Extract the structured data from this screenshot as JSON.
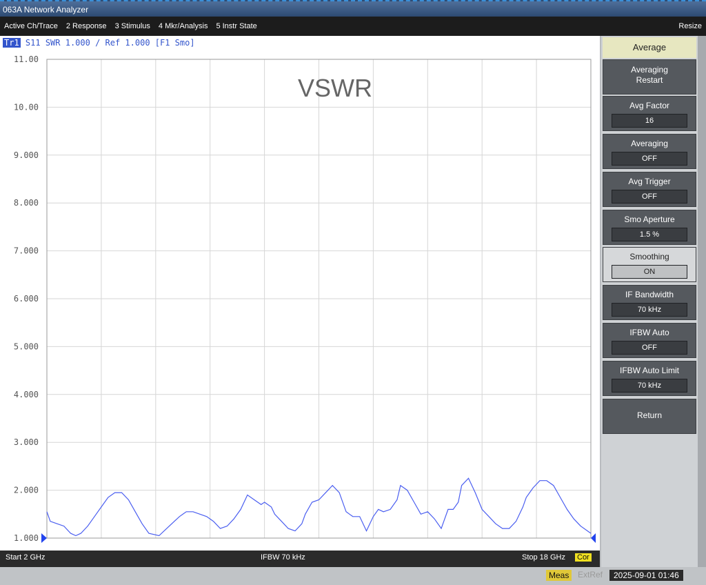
{
  "window": {
    "title": "063A Network Analyzer"
  },
  "menu": {
    "items": [
      "Active Ch/Trace",
      "2 Response",
      "3 Stimulus",
      "4 Mkr/Analysis",
      "5 Instr State"
    ],
    "resize_label": "Resize"
  },
  "trace": {
    "id": "Tr1",
    "info": "S11 SWR 1.000 / Ref 1.000  [F1 Smo]"
  },
  "annotation": "VSWR",
  "chart_data": {
    "type": "line",
    "title": "",
    "xlabel": "",
    "ylabel": "",
    "xlim": [
      2,
      18
    ],
    "ylim": [
      1.0,
      11.0
    ],
    "grid": true,
    "x_divisions": 10,
    "y_ticks": [
      1.0,
      2.0,
      3.0,
      4.0,
      5.0,
      6.0,
      7.0,
      8.0,
      9.0,
      10.0,
      11.0
    ],
    "y_tick_labels": [
      "1.000",
      "2.000",
      "3.000",
      "4.000",
      "5.000",
      "6.000",
      "7.000",
      "8.000",
      "9.000",
      "10.00",
      "11.00"
    ],
    "series": [
      {
        "color": "#4a5ef0",
        "x": [
          2.0,
          2.1,
          2.3,
          2.5,
          2.7,
          2.85,
          3.0,
          3.2,
          3.4,
          3.6,
          3.8,
          4.0,
          4.2,
          4.4,
          4.6,
          4.8,
          5.0,
          5.3,
          5.6,
          5.9,
          6.0,
          6.1,
          6.3,
          6.5,
          6.7,
          6.9,
          7.1,
          7.3,
          7.5,
          7.7,
          7.9,
          8.1,
          8.3,
          8.4,
          8.6,
          8.7,
          8.9,
          9.1,
          9.3,
          9.5,
          9.6,
          9.8,
          10.0,
          10.2,
          10.4,
          10.6,
          10.8,
          11.0,
          11.2,
          11.4,
          11.6,
          11.75,
          11.9,
          12.1,
          12.3,
          12.4,
          12.6,
          12.8,
          13.0,
          13.2,
          13.4,
          13.6,
          13.8,
          13.95,
          14.1,
          14.2,
          14.4,
          14.6,
          14.8,
          15.0,
          15.2,
          15.4,
          15.6,
          15.8,
          16.0,
          16.1,
          16.3,
          16.5,
          16.7,
          16.9,
          17.1,
          17.3,
          17.5,
          17.7,
          17.9,
          18.0
        ],
        "y": [
          1.55,
          1.35,
          1.3,
          1.25,
          1.1,
          1.05,
          1.1,
          1.25,
          1.45,
          1.65,
          1.85,
          1.95,
          1.95,
          1.8,
          1.55,
          1.3,
          1.1,
          1.05,
          1.25,
          1.45,
          1.5,
          1.55,
          1.55,
          1.5,
          1.45,
          1.35,
          1.2,
          1.25,
          1.4,
          1.6,
          1.9,
          1.8,
          1.7,
          1.75,
          1.65,
          1.5,
          1.35,
          1.2,
          1.15,
          1.3,
          1.5,
          1.75,
          1.8,
          1.95,
          2.1,
          1.95,
          1.55,
          1.45,
          1.45,
          1.15,
          1.45,
          1.6,
          1.55,
          1.6,
          1.8,
          2.1,
          2.0,
          1.75,
          1.5,
          1.55,
          1.4,
          1.2,
          1.6,
          1.6,
          1.75,
          2.1,
          2.25,
          1.95,
          1.6,
          1.45,
          1.3,
          1.2,
          1.2,
          1.35,
          1.65,
          1.85,
          2.05,
          2.2,
          2.2,
          2.1,
          1.85,
          1.6,
          1.4,
          1.25,
          1.15,
          1.1
        ]
      }
    ]
  },
  "softkeys": {
    "title": "Average",
    "items": [
      {
        "label": "Averaging Restart",
        "value": ""
      },
      {
        "label": "Avg Factor",
        "value": "16"
      },
      {
        "label": "Averaging",
        "value": "OFF"
      },
      {
        "label": "Avg Trigger",
        "value": "OFF"
      },
      {
        "label": "Smo Aperture",
        "value": "1.5 %"
      },
      {
        "label": "Smoothing",
        "value": "ON"
      },
      {
        "label": "IF Bandwidth",
        "value": "70 kHz"
      },
      {
        "label": "IFBW Auto",
        "value": "OFF"
      },
      {
        "label": "IFBW Auto Limit",
        "value": "70 kHz"
      },
      {
        "label": "Return",
        "value": ""
      }
    ]
  },
  "status": {
    "start": "Start 2 GHz",
    "ifbw": "IFBW 70 kHz",
    "stop": "Stop 18 GHz",
    "cor": "Cor"
  },
  "bottom": {
    "meas": "Meas",
    "extref": "ExtRef",
    "datetime": "2025-09-01 01:46"
  }
}
